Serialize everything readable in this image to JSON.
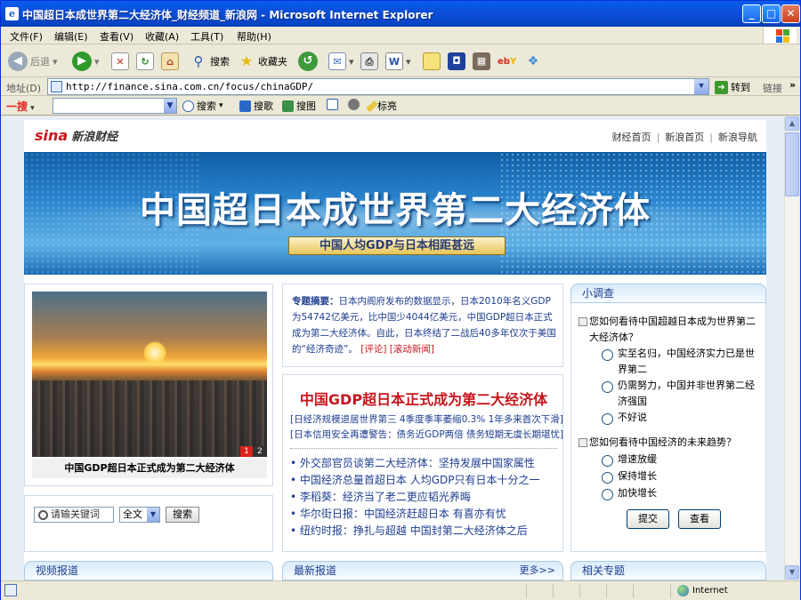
{
  "window": {
    "title": "中国超日本成世界第二大经济体_财经频道_新浪网 - Microsoft Internet Explorer"
  },
  "menu": [
    "文件(F)",
    "编辑(E)",
    "查看(V)",
    "收藏(A)",
    "工具(T)",
    "帮助(H)"
  ],
  "toolbar": {
    "back": "后退",
    "search": "搜索",
    "favorites": "收藏夹"
  },
  "address": {
    "label": "地址(D)",
    "url": "http://finance.sina.com.cn/focus/chinaGDP/",
    "go": "转到",
    "links": "链接"
  },
  "searchbar": {
    "brand": "一搜",
    "search": "搜索",
    "music": "搜歌",
    "image": "搜图",
    "bookmark": "标亮"
  },
  "site": {
    "logo_brand": "sina",
    "logo_text": "新浪财经",
    "nav": [
      "财经首页",
      "新浪首页",
      "新浪导航"
    ]
  },
  "banner": {
    "title": "中国超日本成世界第二大经济体",
    "subtitle": "中国人均GDP与日本相距甚远"
  },
  "photo": {
    "caption": "中国GDP超日本正式成为第二大经济体",
    "pages": [
      "1",
      "2"
    ]
  },
  "summary": {
    "label": "专题摘要：",
    "text": "日本内阁府发布的数据显示，日本2010年名义GDP为54742亿美元，比中国少4044亿美元，中国GDP超日本正式成为第二大经济体。自此，日本终结了二战后40多年仅次于美国的“经济奇迹”。",
    "links": [
      "[评论]",
      "[滚动新闻]"
    ]
  },
  "headline": "中国GDP超日本正式成为第二大经济体",
  "sublinks": [
    "[日经济规模退居世界第三 4季度季率萎缩0.3% 1年多来首次下滑]",
    "[日本信用安全再遭警告：债务近GDP两倍 债务短期无虞长期堪忧]"
  ],
  "news": [
    "外交部官员谈第二大经济体：坚持发展中国家属性",
    "中国经济总量首超日本 人均GDP只有日本十分之一",
    "李稻葵：经济当了老二更应韬光养晦",
    "华尔街日报：中国经济赶超日本 有喜亦有忧",
    "纽约时报：挣扎与超越 中国封第二大经济体之后"
  ],
  "poll": {
    "title": "小调查",
    "q1": "您如何看待中国超越日本成为世界第二大经济体？",
    "q1_options": [
      "实至名归，中国经济实力已是世界第二",
      "仍需努力，中国并非世界第二经济强国",
      "不好说"
    ],
    "q2": "您如何看待中国经济的未来趋势？",
    "q2_options": [
      "增速放缓",
      "保持增长",
      "加快增长"
    ],
    "submit": "提交",
    "view": "查看"
  },
  "search": {
    "placeholder": "请输关键词",
    "scope": "全文",
    "button": "搜索"
  },
  "sections": {
    "video": "视频报道",
    "latest": "最新报道",
    "more": "更多>>",
    "related": "相关专题"
  },
  "status": {
    "zone": "Internet"
  }
}
